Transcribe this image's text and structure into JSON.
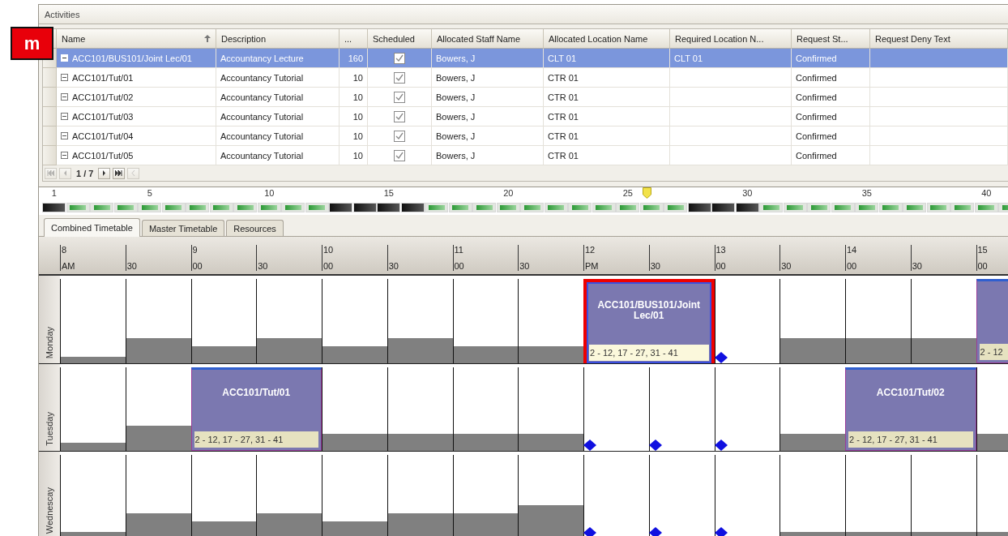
{
  "badge": {
    "text": "m"
  },
  "panel": {
    "title": "Activities"
  },
  "table": {
    "columns": [
      {
        "label": "Name",
        "sorted": true
      },
      {
        "label": "Description",
        "sorted": false
      },
      {
        "label": "...",
        "sorted": false
      },
      {
        "label": "Scheduled",
        "sorted": false
      },
      {
        "label": "Allocated Staff Name",
        "sorted": false
      },
      {
        "label": "Allocated Location Name",
        "sorted": false
      },
      {
        "label": "Required Location N...",
        "sorted": false
      },
      {
        "label": "Request St...",
        "sorted": false
      },
      {
        "label": "Request Deny Text",
        "sorted": false
      }
    ],
    "rows": [
      {
        "selected": true,
        "name": "ACC101/BUS101/Joint Lec/01",
        "description": "Accountancy Lecture",
        "size": "160",
        "scheduled": true,
        "staff": "Bowers, J",
        "allocated_location": "CLT 01",
        "required_location": "CLT 01",
        "request_status": "Confirmed"
      },
      {
        "selected": false,
        "name": "ACC101/Tut/01",
        "description": "Accountancy Tutorial",
        "size": "10",
        "scheduled": true,
        "staff": "Bowers, J",
        "allocated_location": "CTR 01",
        "request_status": "Confirmed"
      },
      {
        "selected": false,
        "name": "ACC101/Tut/02",
        "description": "Accountancy Tutorial",
        "size": "10",
        "scheduled": true,
        "staff": "Bowers, J",
        "allocated_location": "CTR 01",
        "request_status": "Confirmed"
      },
      {
        "selected": false,
        "name": "ACC101/Tut/03",
        "description": "Accountancy Tutorial",
        "size": "10",
        "scheduled": true,
        "staff": "Bowers, J",
        "allocated_location": "CTR 01",
        "request_status": "Confirmed"
      },
      {
        "selected": false,
        "name": "ACC101/Tut/04",
        "description": "Accountancy Tutorial",
        "size": "10",
        "scheduled": true,
        "staff": "Bowers, J",
        "allocated_location": "CTR 01",
        "request_status": "Confirmed"
      },
      {
        "selected": false,
        "name": "ACC101/Tut/05",
        "description": "Accountancy Tutorial",
        "size": "10",
        "scheduled": true,
        "staff": "Bowers, J",
        "allocated_location": "CTR 01",
        "request_status": "Confirmed"
      }
    ],
    "pager": {
      "text": "1 / 7"
    }
  },
  "weeks": [
    {
      "label": "1",
      "scheduled": false,
      "current": false
    },
    {
      "scheduled": true,
      "current": false
    },
    {
      "scheduled": true,
      "current": false
    },
    {
      "scheduled": true,
      "current": false
    },
    {
      "label": "5",
      "scheduled": true,
      "current": false
    },
    {
      "scheduled": true,
      "current": false
    },
    {
      "scheduled": true,
      "current": false
    },
    {
      "scheduled": true,
      "current": false
    },
    {
      "scheduled": true,
      "current": false
    },
    {
      "label": "10",
      "scheduled": true,
      "current": false
    },
    {
      "scheduled": true,
      "current": false
    },
    {
      "scheduled": true,
      "current": false
    },
    {
      "scheduled": false,
      "current": false
    },
    {
      "scheduled": false,
      "current": false
    },
    {
      "label": "15",
      "scheduled": false,
      "current": false
    },
    {
      "scheduled": false,
      "current": false
    },
    {
      "scheduled": true,
      "current": false
    },
    {
      "scheduled": true,
      "current": false
    },
    {
      "scheduled": true,
      "current": false
    },
    {
      "label": "20",
      "scheduled": true,
      "current": false
    },
    {
      "scheduled": true,
      "current": false
    },
    {
      "scheduled": true,
      "current": false
    },
    {
      "scheduled": true,
      "current": false
    },
    {
      "scheduled": true,
      "current": false
    },
    {
      "label": "25",
      "scheduled": true,
      "current": false
    },
    {
      "scheduled": true,
      "current": true
    },
    {
      "scheduled": true,
      "current": false
    },
    {
      "scheduled": false,
      "current": false
    },
    {
      "scheduled": false,
      "current": false
    },
    {
      "label": "30",
      "scheduled": false,
      "current": false
    },
    {
      "scheduled": true,
      "current": false
    },
    {
      "scheduled": true,
      "current": false
    },
    {
      "scheduled": true,
      "current": false
    },
    {
      "scheduled": true,
      "current": false
    },
    {
      "label": "35",
      "scheduled": true,
      "current": false
    },
    {
      "scheduled": true,
      "current": false
    },
    {
      "scheduled": true,
      "current": false
    },
    {
      "scheduled": true,
      "current": false
    },
    {
      "scheduled": true,
      "current": false
    },
    {
      "label": "40",
      "scheduled": true,
      "current": false
    },
    {
      "scheduled": true,
      "current": false
    }
  ],
  "tabs": [
    {
      "label": "Combined Timetable",
      "selected": true
    },
    {
      "label": "Master Timetable",
      "selected": false
    },
    {
      "label": "Resources",
      "selected": false
    }
  ],
  "time_header": [
    {
      "hour": "8",
      "minute": "AM"
    },
    {
      "minute": "30"
    },
    {
      "hour": "9",
      "minute": "00"
    },
    {
      "minute": "30"
    },
    {
      "hour": "10",
      "minute": "00"
    },
    {
      "minute": "30"
    },
    {
      "hour": "11",
      "minute": "00"
    },
    {
      "minute": "30"
    },
    {
      "hour": "12",
      "minute": "PM"
    },
    {
      "minute": "30"
    },
    {
      "hour": "13",
      "minute": "00"
    },
    {
      "minute": "30"
    },
    {
      "hour": "14",
      "minute": "00"
    },
    {
      "minute": "30"
    },
    {
      "hour": "15",
      "minute": "00"
    }
  ],
  "days": [
    {
      "label": "Monday",
      "cells": [
        {
          "level": 0.08,
          "marker": false
        },
        {
          "level": 0.3,
          "marker": false
        },
        {
          "level": 0.2,
          "marker": false
        },
        {
          "level": 0.3,
          "marker": false
        },
        {
          "level": 0.2,
          "marker": false
        },
        {
          "level": 0.3,
          "marker": false
        },
        {
          "level": 0.2,
          "marker": false
        },
        {
          "level": 0.2,
          "marker": false
        },
        {
          "event": {
            "title": "ACC101/BUS101/Joint Lec/01",
            "weeks": "2 - 12, 17 - 27, 31 - 41",
            "selected": true
          }
        },
        {},
        {
          "marker": true
        },
        {
          "level": 0.3,
          "marker": false
        },
        {
          "level": 0.3,
          "marker": false
        },
        {
          "level": 0.3,
          "marker": false
        },
        {
          "event": {
            "weeks": "2 - 12",
            "selected": false
          }
        }
      ]
    },
    {
      "label": "Tuesday",
      "cells": [
        {
          "level": 0.1,
          "marker": false
        },
        {
          "level": 0.3,
          "marker": false
        },
        {
          "event": {
            "title": "ACC101/Tut/01",
            "weeks": "2 - 12, 17 - 27, 31 - 41",
            "selected": false
          }
        },
        {},
        {
          "level": 0.2,
          "marker": false
        },
        {
          "level": 0.2,
          "marker": false
        },
        {
          "level": 0.2,
          "marker": false
        },
        {
          "level": 0.2,
          "marker": false
        },
        {
          "marker": true
        },
        {
          "marker": true
        },
        {
          "marker": true
        },
        {
          "level": 0.2,
          "marker": false
        },
        {
          "event": {
            "title": "ACC101/Tut/02",
            "weeks": "2 - 12, 17 - 27, 31 - 41",
            "selected": false
          }
        },
        {},
        {
          "level": 0.2,
          "marker": false
        }
      ]
    },
    {
      "label": "Wednescay",
      "cells": [
        {
          "level": 0.08,
          "marker": false
        },
        {
          "level": 0.3,
          "marker": false
        },
        {
          "level": 0.2,
          "marker": false
        },
        {
          "level": 0.3,
          "marker": false
        },
        {
          "level": 0.2,
          "marker": false
        },
        {
          "level": 0.3,
          "marker": false
        },
        {
          "level": 0.3,
          "marker": false
        },
        {
          "level": 0.4,
          "marker": false
        },
        {
          "marker": true
        },
        {
          "marker": true
        },
        {
          "marker": true
        },
        {
          "level": 0.08,
          "marker": false
        },
        {
          "level": 0.08,
          "marker": false
        },
        {
          "level": 0.08,
          "marker": false
        },
        {
          "level": 0.08,
          "marker": false
        }
      ]
    }
  ]
}
